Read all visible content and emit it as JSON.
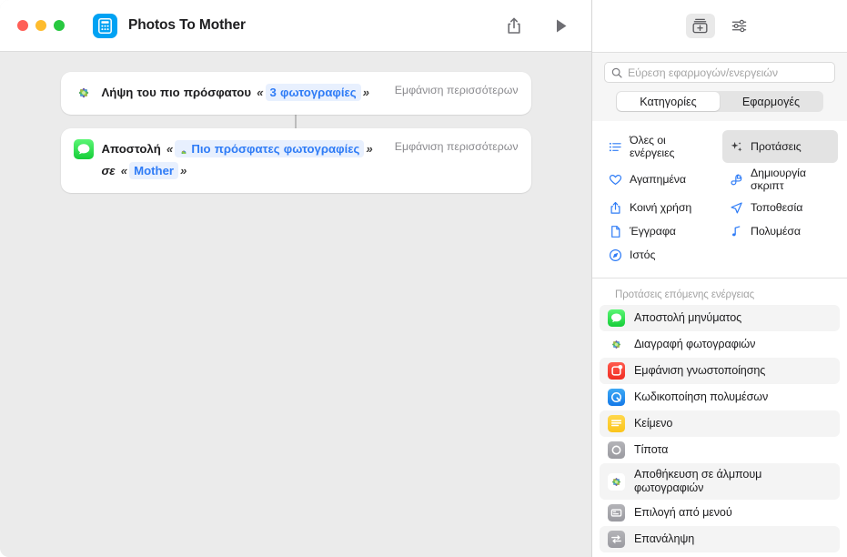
{
  "window": {
    "title": "Photos To Mother",
    "app_icon": "shortcut-calculator-icon",
    "traffic_lights": [
      "close-button",
      "minimize-button",
      "zoom-button"
    ],
    "toolbar": {
      "share_label": "share-icon",
      "run_label": "play-icon"
    }
  },
  "workflow": {
    "actions": [
      {
        "icon": "photos-app-icon",
        "show_more": "Εμφάνιση περισσότερων",
        "parts": [
          {
            "type": "text",
            "value": "Λήψη του πιο πρόσφατου"
          },
          {
            "type": "guillemet",
            "value": "«"
          },
          {
            "type": "token",
            "value": "3 φωτογραφίες"
          },
          {
            "type": "guillemet",
            "value": "»"
          }
        ]
      },
      {
        "icon": "messages-app-icon",
        "show_more": "Εμφάνιση περισσότερων",
        "parts": [
          {
            "type": "text",
            "value": "Αποστολή"
          },
          {
            "type": "guillemet",
            "value": "«"
          },
          {
            "type": "token-var",
            "value": "Πιο πρόσφατες φωτογραφίες"
          },
          {
            "type": "guillemet",
            "value": "»"
          },
          {
            "type": "italic",
            "value": "σε"
          },
          {
            "type": "guillemet",
            "value": "«"
          },
          {
            "type": "token",
            "value": "Mother"
          },
          {
            "type": "guillemet",
            "value": "»"
          }
        ]
      }
    ]
  },
  "sidebar": {
    "toolbar": {
      "library_icon": "action-library-icon",
      "settings_icon": "sliders-icon"
    },
    "search": {
      "placeholder": "Εύρεση εφαρμογών/ενεργειών",
      "value": "",
      "icon": "search-icon"
    },
    "segmented": {
      "options": [
        "Κατηγορίες",
        "Εφαρμογές"
      ],
      "selected": "Κατηγορίες"
    },
    "categories": [
      {
        "label": "Όλες οι ενέργειες",
        "icon": "list-icon",
        "selected": false
      },
      {
        "label": "Προτάσεις",
        "icon": "sparkles-icon",
        "selected": true
      },
      {
        "label": "Αγαπημένα",
        "icon": "heart-icon",
        "selected": false
      },
      {
        "label": "Δημιουργία σκριπτ",
        "icon": "scripting-icon",
        "selected": false
      },
      {
        "label": "Κοινή χρήση",
        "icon": "share-icon",
        "selected": false
      },
      {
        "label": "Τοποθεσία",
        "icon": "location-arrow-icon",
        "selected": false
      },
      {
        "label": "Έγγραφα",
        "icon": "document-icon",
        "selected": false
      },
      {
        "label": "Πολυμέσα",
        "icon": "music-note-icon",
        "selected": false
      },
      {
        "label": "Ιστός",
        "icon": "compass-icon",
        "selected": false
      }
    ],
    "suggestions": {
      "header": "Προτάσεις επόμενης ενέργειας",
      "items": [
        {
          "label": "Αποστολή μηνύματος",
          "icon": "messages-app-icon"
        },
        {
          "label": "Διαγραφή φωτογραφιών",
          "icon": "photos-app-icon"
        },
        {
          "label": "Εμφάνιση γνωστοποίησης",
          "icon": "notification-icon"
        },
        {
          "label": "Κωδικοποίηση πολυμέσων",
          "icon": "media-encode-icon"
        },
        {
          "label": "Κείμενο",
          "icon": "text-icon"
        },
        {
          "label": "Τίποτα",
          "icon": "nothing-icon"
        },
        {
          "label": "Αποθήκευση σε άλμπουμ φωτογραφιών",
          "icon": "photos-app-icon"
        },
        {
          "label": "Επιλογή από μενού",
          "icon": "menu-icon"
        },
        {
          "label": "Επανάληψη",
          "icon": "repeat-icon"
        }
      ]
    }
  },
  "colors": {
    "accent_blue": "#2f7cf6",
    "canvas": "#ebebeb",
    "token_bg": "#e8f0fe",
    "app_icon_bg": "#00a2f3"
  }
}
